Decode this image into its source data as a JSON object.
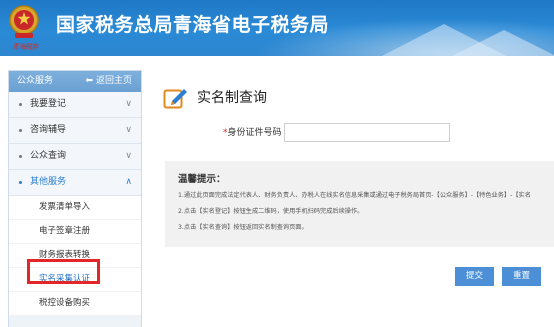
{
  "header": {
    "title": "国家税务总局青海省电子税务局",
    "emblem_caption": "青海税务"
  },
  "sidebar": {
    "heading": "公众服务",
    "back_label": "返回主页",
    "menu": [
      {
        "label": "我要登记",
        "open": false
      },
      {
        "label": "咨询辅导",
        "open": false
      },
      {
        "label": "公众查询",
        "open": false
      },
      {
        "label": "其他服务",
        "open": true
      }
    ],
    "sub_items": [
      {
        "label": "发票清单导入"
      },
      {
        "label": "电子签章注册"
      },
      {
        "label": "财务报表转换"
      },
      {
        "label": "实名采集认证",
        "active": true
      },
      {
        "label": "税控设备购买"
      }
    ]
  },
  "main": {
    "title": "实名制查询",
    "field_required_mark": "*",
    "field_label": "身份证件号码",
    "field_value": "",
    "tips_title": "温馨提示：",
    "tips": [
      "1.通过此页面完成法定代表人、财务负责人、办税人在线实名信息采集或通过电子税务局首页-【公众服务】-【特色业务】-【实名",
      "2.点击【实名登记】按钮生成二维码，使用手机扫码完成后续操作。",
      "3.点击【实名查询】按钮返回实名制查询页面。"
    ],
    "submit_label": "提交",
    "reset_label": "重置"
  },
  "colors": {
    "header_blue": "#2a8ad6",
    "button_blue": "#4d8fd6",
    "highlight_red": "#e3262a",
    "required_red": "#e02020"
  }
}
